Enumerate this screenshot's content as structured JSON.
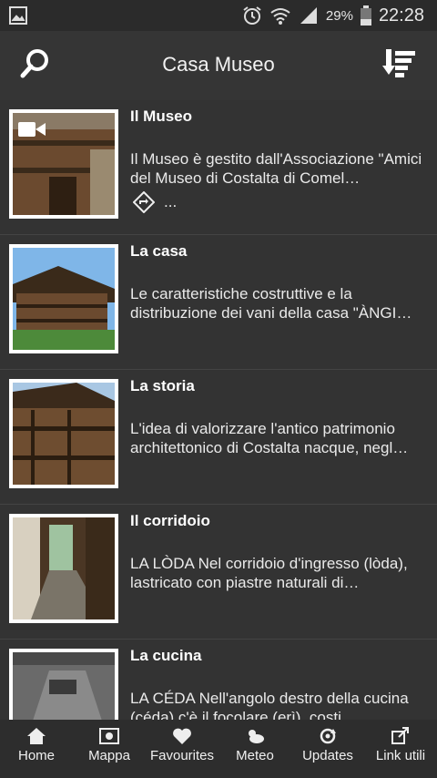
{
  "status_bar": {
    "battery_percent": "29%",
    "time": "22:28",
    "icons": [
      "gallery-icon",
      "alarm-icon",
      "wifi-icon",
      "signal-icon",
      "battery-icon"
    ]
  },
  "header": {
    "title": "Casa Museo",
    "left_icon": "search-icon",
    "right_icon": "sort-icon"
  },
  "items": [
    {
      "title": "Il Museo",
      "description": " Il Museo è gestito dall'Associazione \"Amici del Museo di Costalta di Comel…",
      "has_video": true,
      "link_text": "..."
    },
    {
      "title": "La casa",
      "description": " Le caratteristiche costruttive e la distribuzione dei vani della casa \"ÀNGI…"
    },
    {
      "title": "La storia",
      "description": " L'idea di valorizzare l'antico patrimonio architettonico di Costalta nacque, negl…"
    },
    {
      "title": "Il corridoio",
      "description": " LA LÒDA  Nel corridoio d'ingresso (lòda), lastricato con piastre naturali di…"
    },
    {
      "title": "La cucina",
      "description": " LA CÉDA  Nell'angolo destro della cucina (céda) c'è il focolare (erì), costi…"
    }
  ],
  "bottom_nav": [
    {
      "label": "Home",
      "icon": "home-icon"
    },
    {
      "label": "Mappa",
      "icon": "map-icon"
    },
    {
      "label": "Favourites",
      "icon": "heart-icon"
    },
    {
      "label": "Meteo",
      "icon": "weather-icon"
    },
    {
      "label": "Updates",
      "icon": "updates-icon"
    },
    {
      "label": "Link utili",
      "icon": "external-link-icon"
    }
  ]
}
